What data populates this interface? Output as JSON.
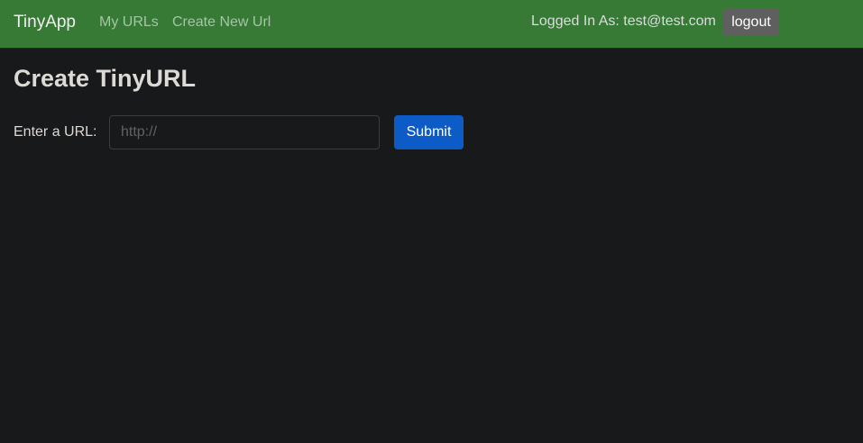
{
  "nav": {
    "brand": "TinyApp",
    "links": [
      "My URLs",
      "Create New Url"
    ],
    "logged_in_text": "Logged In As: test@test.com",
    "logout_label": "logout"
  },
  "main": {
    "title": "Create TinyURL",
    "url_label": "Enter a URL:",
    "url_value": "",
    "url_placeholder": "http://",
    "submit_label": "Submit"
  },
  "colors": {
    "navbar": "#367a36",
    "background": "#18191b",
    "primary": "#0d5bc6"
  }
}
